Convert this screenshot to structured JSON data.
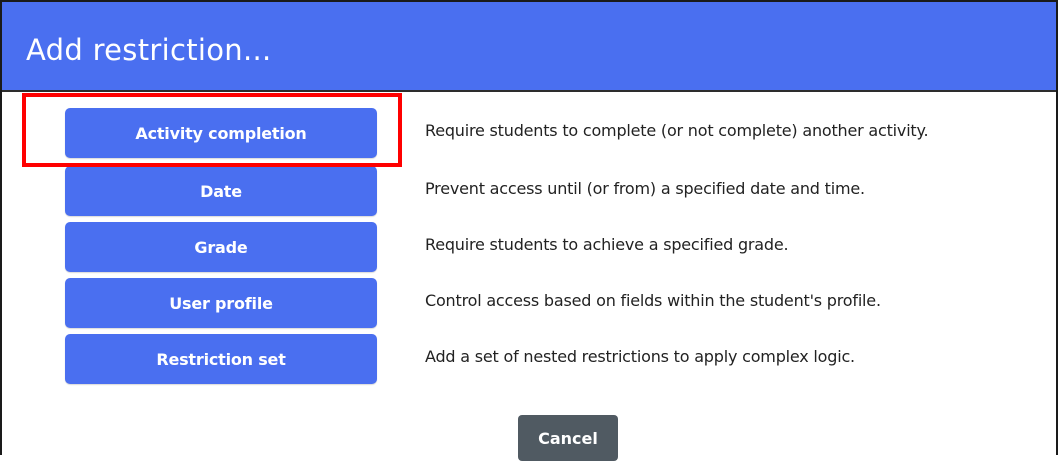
{
  "dialog": {
    "title": "Add restriction..."
  },
  "options": [
    {
      "label": "Activity completion",
      "description": "Require students to complete (or not complete) another activity."
    },
    {
      "label": "Date",
      "description": "Prevent access until (or from) a specified date and time."
    },
    {
      "label": "Grade",
      "description": "Require students to achieve a specified grade."
    },
    {
      "label": "User profile",
      "description": "Control access based on fields within the student's profile."
    },
    {
      "label": "Restriction set",
      "description": "Add a set of nested restrictions to apply complex logic."
    }
  ],
  "footer": {
    "cancel_label": "Cancel"
  },
  "colors": {
    "header_bg": "#4a6ff0",
    "button_bg": "#4a6ff0",
    "cancel_bg": "#505a62",
    "highlight": "#ff0000"
  }
}
